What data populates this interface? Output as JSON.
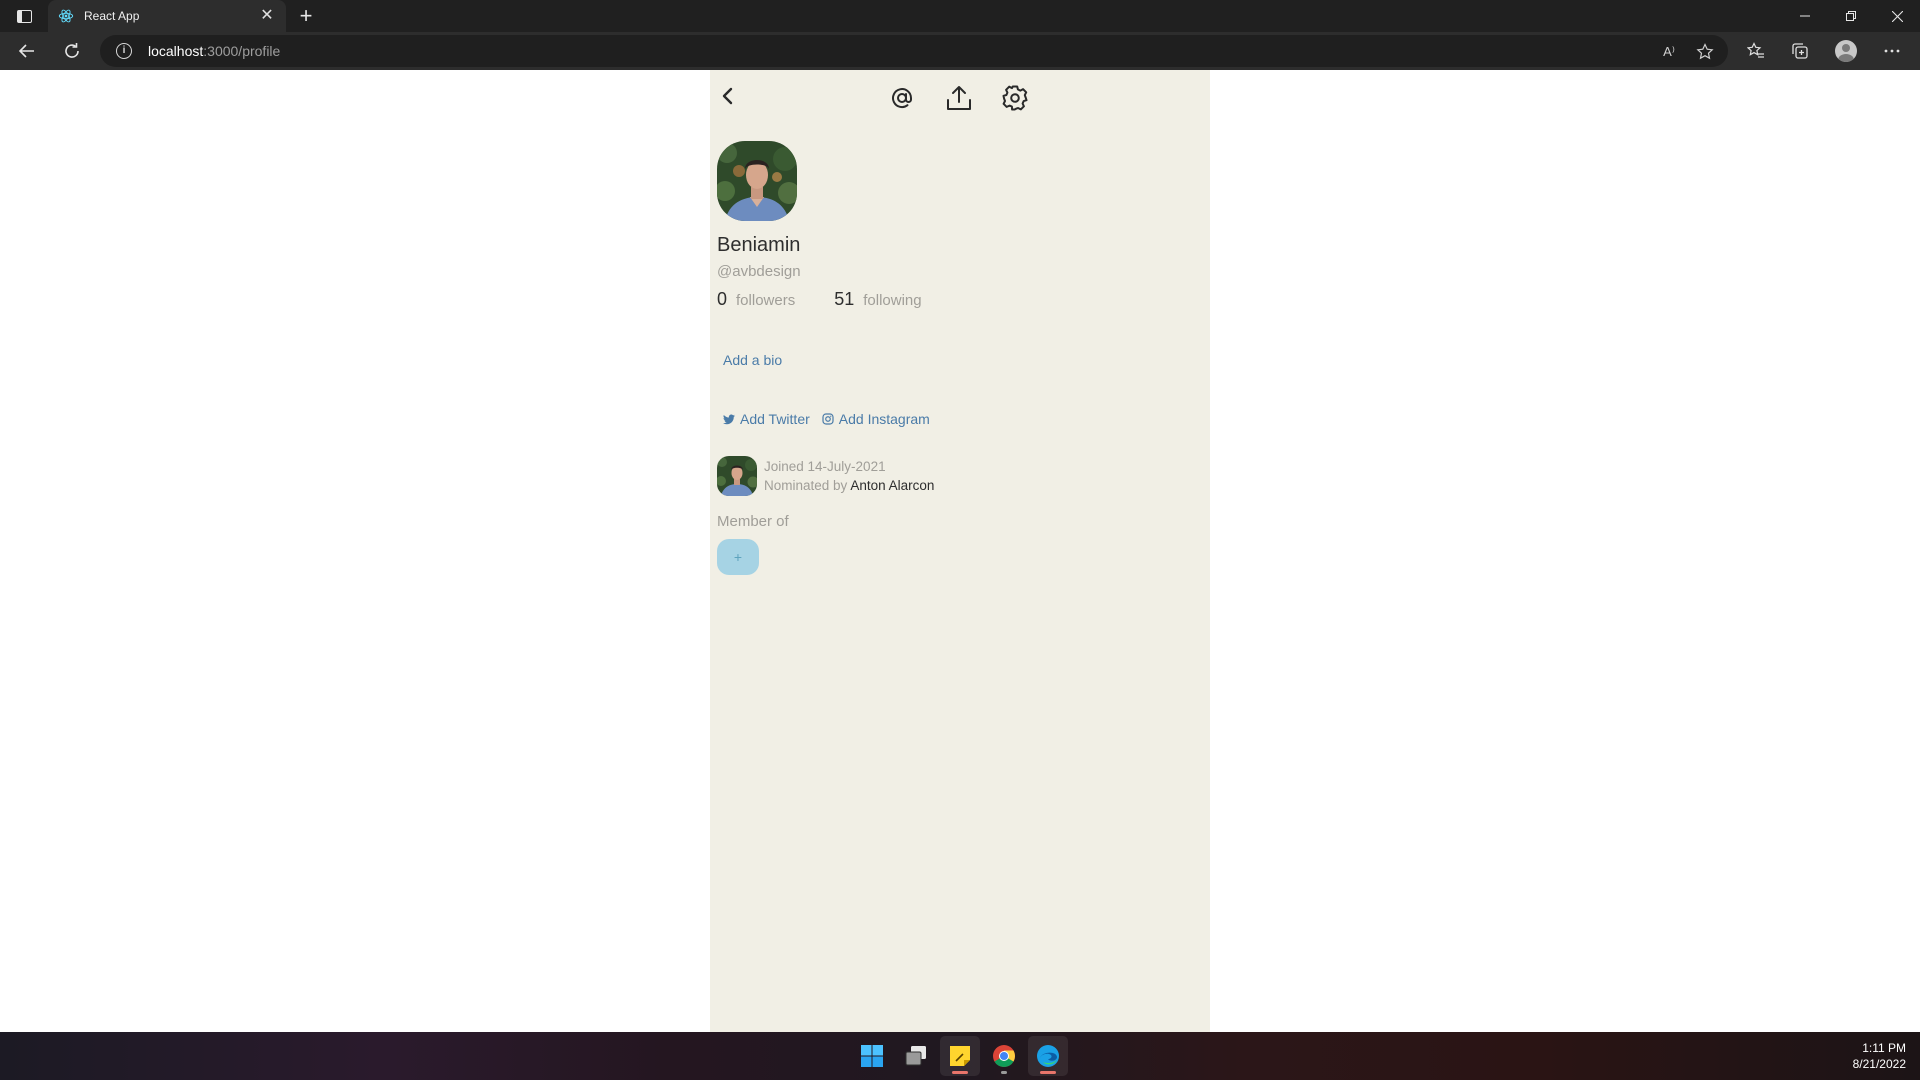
{
  "browser": {
    "tab_title": "React App",
    "tab_close": "✕",
    "new_tab": "+",
    "url_host": "localhost",
    "url_path": ":3000/profile",
    "info_icon": "i",
    "read_aloud_icon": "A⁾"
  },
  "profile": {
    "name": "Beniamin",
    "handle": "@avbdesign",
    "followers_count": "0",
    "followers_label": "followers",
    "following_count": "51",
    "following_label": "following",
    "add_bio": "Add a bio",
    "add_twitter": "Add Twitter",
    "add_instagram": "Add Instagram",
    "joined": "Joined 14-July-2021",
    "nominated_prefix": "Nominated by",
    "nominator": "Anton Alarcon",
    "member_of": "Member of",
    "add_group": "+"
  },
  "taskbar": {
    "time": "1:11 PM",
    "date": "8/21/2022",
    "apps": [
      "windows-start",
      "task-view",
      "sticky-notes",
      "chrome",
      "edge"
    ]
  },
  "colors": {
    "app_background": "#f1efe5",
    "link": "#4a7ba8",
    "muted": "#a09e98",
    "add_group": "#a6d3e4"
  }
}
